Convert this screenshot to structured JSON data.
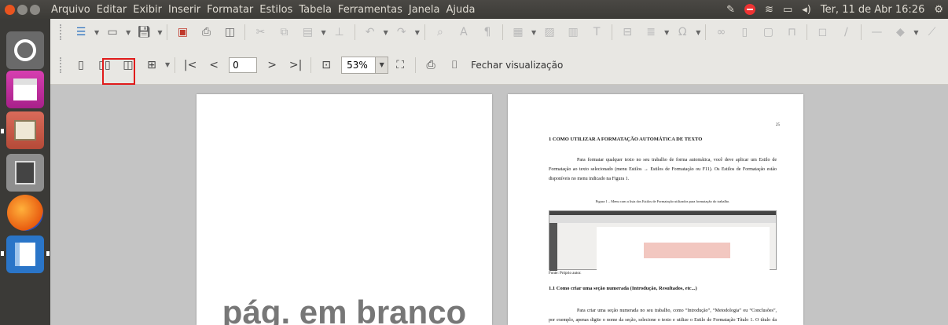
{
  "menubar": {
    "items": [
      "Arquivo",
      "Editar",
      "Exibir",
      "Inserir",
      "Formatar",
      "Estilos",
      "Tabela",
      "Ferramentas",
      "Janela",
      "Ajuda"
    ],
    "clock": "Ter, 11 de Abr 16:26"
  },
  "preview": {
    "page_number": "0",
    "zoom": "53%",
    "close_label": "Fechar visualização"
  },
  "left_page": {
    "label": "pág. em branco"
  },
  "right_page": {
    "page_number": "25",
    "heading": "1 COMO UTILIZAR A FORMATAÇÃO AUTOMÁTICA DE TEXTO",
    "paragraph1": "Para formatar qualquer texto no seu trabalho de forma automática, você deve aplicar um Estilo de Formatação ao texto selecionado (menu Estilos → Estilos de Formatação ou F11). Os Estilos de Formatação estão disponíveis no menu indicado na Figura 1.",
    "figure_caption": "Figura 1 – Menu com a lista dos Estilos de Formatação utilizados para formatação do trabalho.",
    "source": "Fonte: Próprio autor.",
    "subheading": "1.1 Como criar uma seção numerada (Introdução, Resultados, etc...)",
    "paragraph2": "Para criar uma seção numerada no seu trabalho, como “Introdução”, “Metodologia” ou “Conclusões”, por exemplo, apenas digite o nome da seção, selecione o texto e utilize o Estilo de Formatação Título 1. O título da seção deverá ficar igual ao do"
  }
}
